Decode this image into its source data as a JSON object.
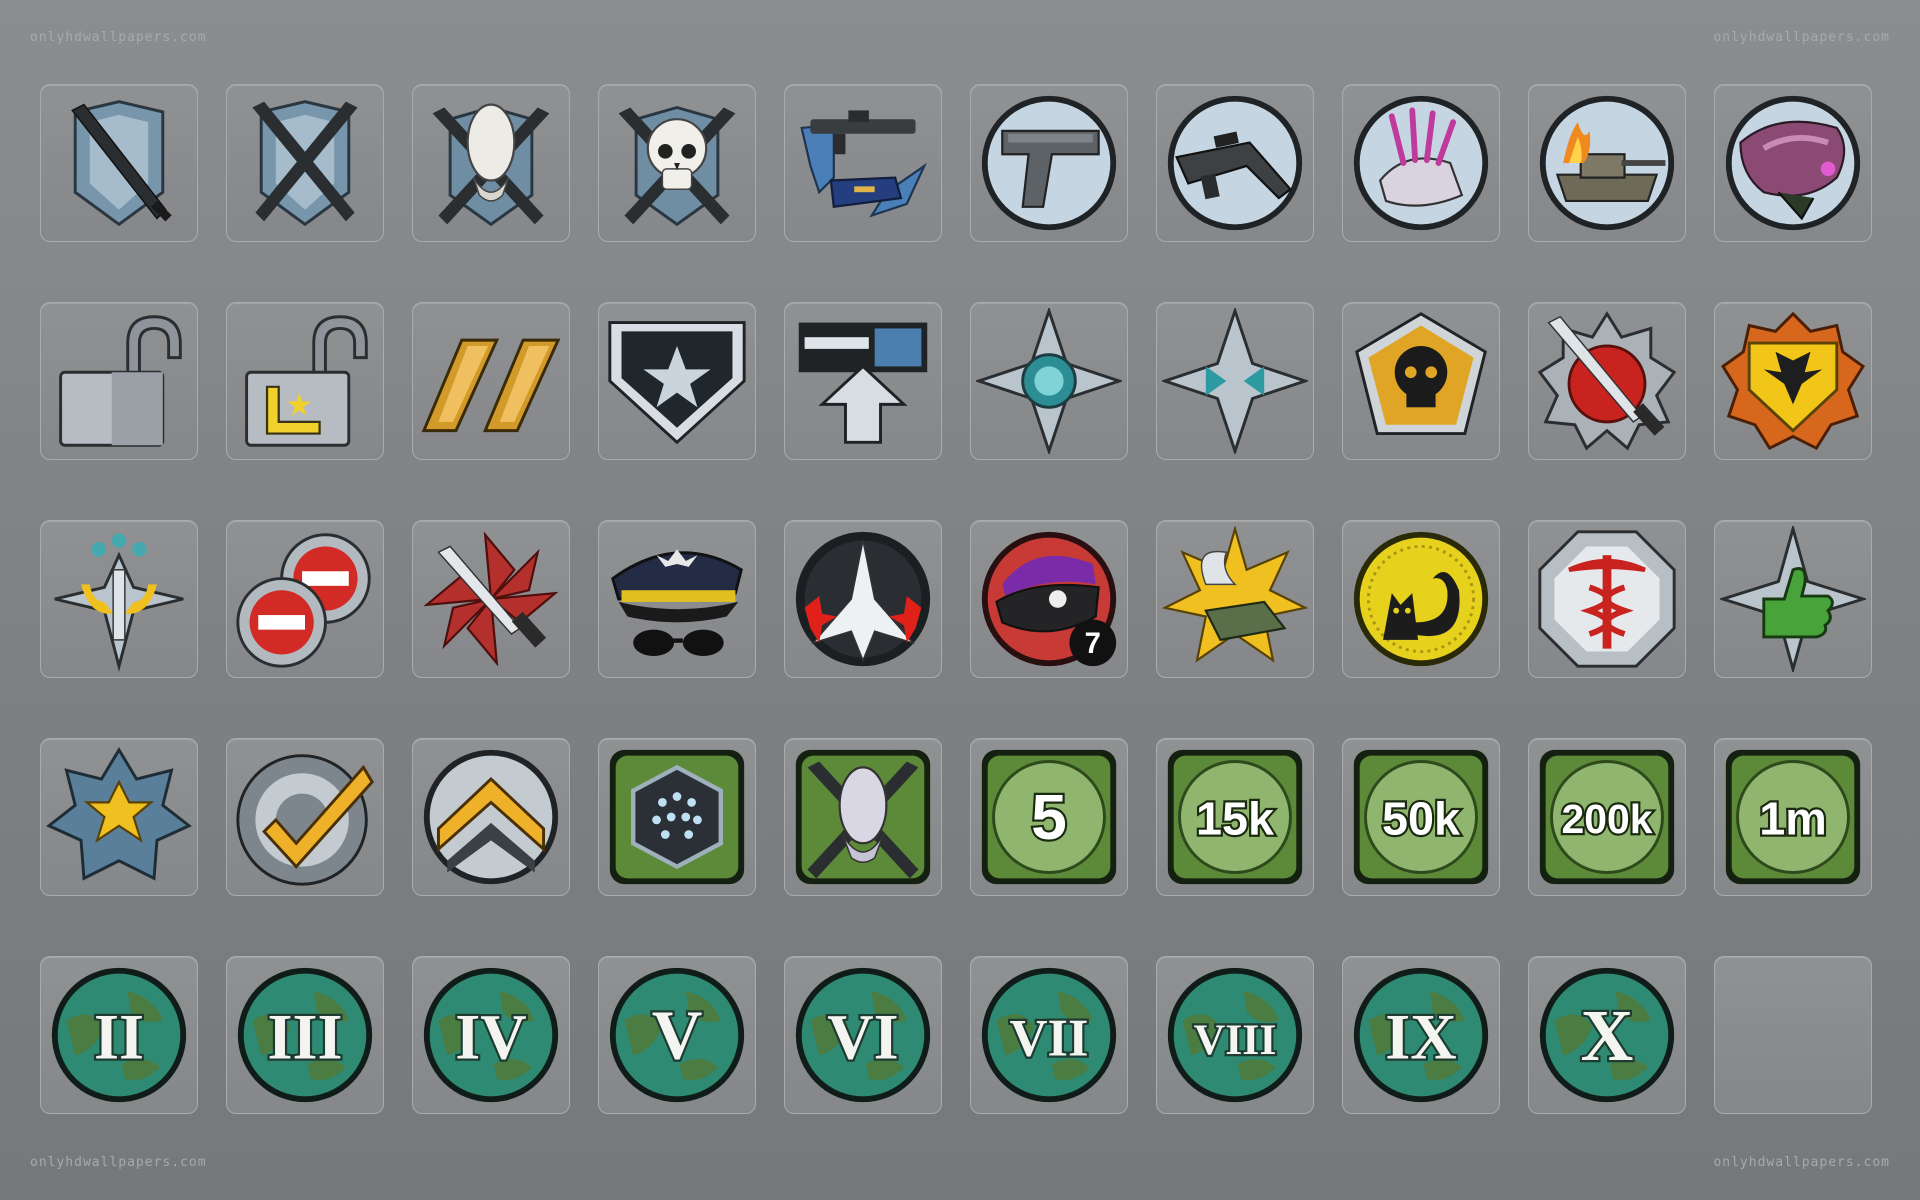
{
  "watermark": {
    "top_left": "onlyhdwallpapers.com",
    "top_right": "onlyhdwallpapers.com",
    "bottom_left": "onlyhdwallpapers.com",
    "bottom_right": "onlyhdwallpapers.com"
  },
  "rows": [
    [
      {
        "icon": "single-blade-emblem-icon"
      },
      {
        "icon": "crossed-blades-emblem-icon"
      },
      {
        "icon": "elite-skull-crossed-blades-icon"
      },
      {
        "icon": "human-skull-crossed-blades-icon"
      },
      {
        "icon": "rifle-switch-arrows-icon"
      },
      {
        "icon": "pistol-icon"
      },
      {
        "icon": "assault-rifle-icon"
      },
      {
        "icon": "needler-icon"
      },
      {
        "icon": "burning-tank-icon"
      },
      {
        "icon": "plasma-pistol-icon"
      }
    ],
    [
      {
        "icon": "open-padlock-icon"
      },
      {
        "icon": "open-padlock-rank-icon"
      },
      {
        "icon": "gold-double-bar-icon"
      },
      {
        "icon": "star-shield-icon"
      },
      {
        "icon": "upload-arrow-icon"
      },
      {
        "icon": "compass-star-target-icon"
      },
      {
        "icon": "compass-star-arrows-icon"
      },
      {
        "icon": "skull-pentagon-badge-icon"
      },
      {
        "icon": "knife-medal-icon"
      },
      {
        "icon": "winged-shield-medal-icon"
      }
    ],
    [
      {
        "icon": "sword-three-stars-icon"
      },
      {
        "icon": "double-no-entry-icon"
      },
      {
        "icon": "knife-pinwheel-icon"
      },
      {
        "icon": "captain-hat-sunglasses-icon"
      },
      {
        "icon": "starfighter-icon"
      },
      {
        "icon": "eight-ball-helmet-icon",
        "label": "7"
      },
      {
        "icon": "winged-boot-star-icon"
      },
      {
        "icon": "lucky-cat-coin-icon"
      },
      {
        "icon": "medic-caduceus-icon"
      },
      {
        "icon": "thumbs-up-star-icon"
      }
    ],
    [
      {
        "icon": "flower-star-icon"
      },
      {
        "icon": "target-checkmark-icon"
      },
      {
        "icon": "double-chevron-icon"
      },
      {
        "icon": "star-cluster-hexagon-icon"
      },
      {
        "icon": "elite-skull-green-icon"
      },
      {
        "icon": "kill-count-badge-icon",
        "label": "5"
      },
      {
        "icon": "kill-count-badge-icon",
        "label": "15k"
      },
      {
        "icon": "kill-count-badge-icon",
        "label": "50k"
      },
      {
        "icon": "kill-count-badge-icon",
        "label": "200k"
      },
      {
        "icon": "kill-count-badge-icon",
        "label": "1m"
      }
    ],
    [
      {
        "icon": "planet-roman-numeral-icon",
        "label": "II"
      },
      {
        "icon": "planet-roman-numeral-icon",
        "label": "III"
      },
      {
        "icon": "planet-roman-numeral-icon",
        "label": "IV"
      },
      {
        "icon": "planet-roman-numeral-icon",
        "label": "V"
      },
      {
        "icon": "planet-roman-numeral-icon",
        "label": "VI"
      },
      {
        "icon": "planet-roman-numeral-icon",
        "label": "VII"
      },
      {
        "icon": "planet-roman-numeral-icon",
        "label": "VIII"
      },
      {
        "icon": "planet-roman-numeral-icon",
        "label": "IX"
      },
      {
        "icon": "planet-roman-numeral-icon",
        "label": "X"
      },
      {
        "icon": "empty-slot"
      }
    ]
  ],
  "colors": {
    "background": "#828486",
    "tile_border": "#a9abad",
    "steel_blue": "#6f8fa6",
    "gold": "#e0a524",
    "badge_green": "#4f7a2c",
    "planet_teal": "#2f8a73"
  }
}
